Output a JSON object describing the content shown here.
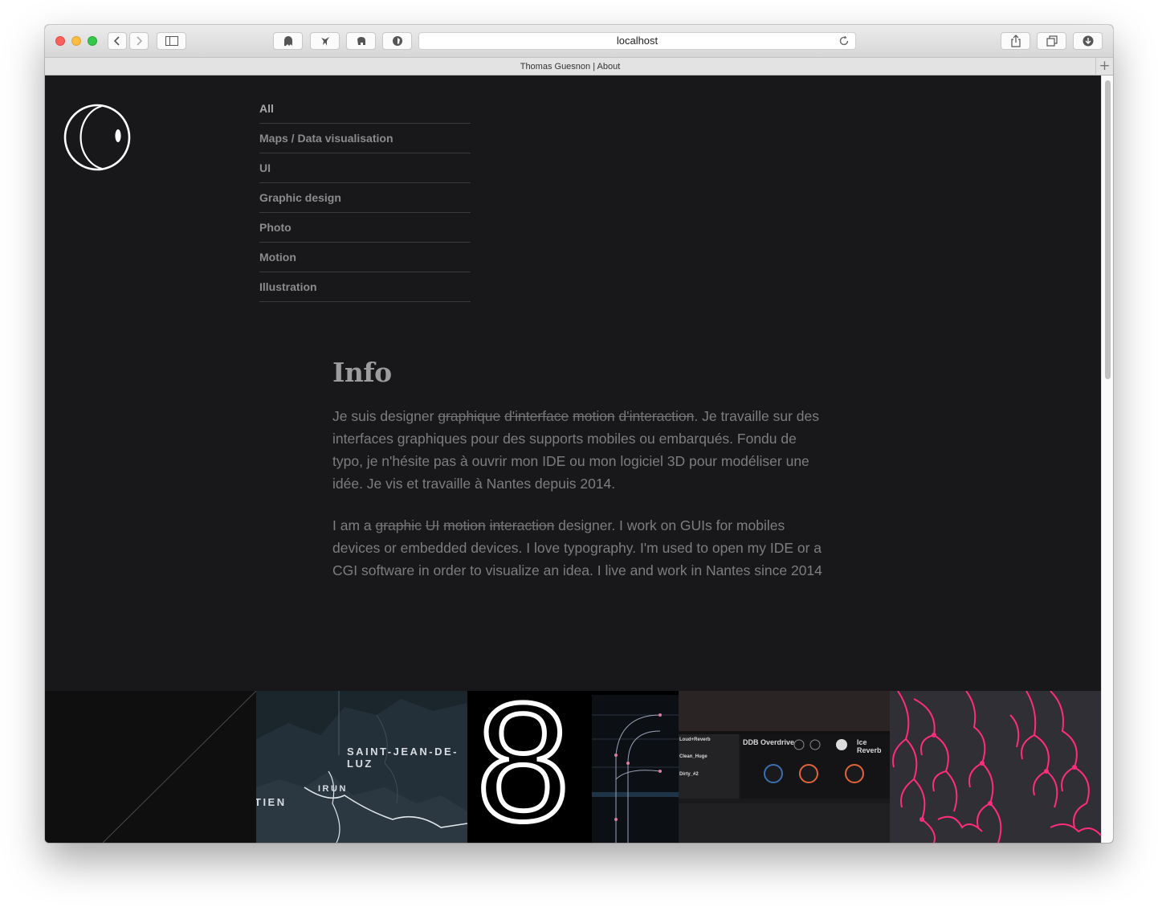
{
  "browser": {
    "url": "localhost",
    "tab_title": "Thomas Guesnon | About",
    "new_tab_label": "+"
  },
  "nav": {
    "items": [
      {
        "label": "All"
      },
      {
        "label": "Maps / Data visualisation"
      },
      {
        "label": "UI"
      },
      {
        "label": "Graphic design"
      },
      {
        "label": "Photo"
      },
      {
        "label": "Motion"
      },
      {
        "label": "Illustration"
      }
    ]
  },
  "info": {
    "title": "Info",
    "fr": {
      "prefix": "Je suis designer ",
      "struck": [
        "graphique",
        "d'interface",
        "motion",
        "d'interaction"
      ],
      "suffix": ". Je travaille sur des interfaces graphiques pour des supports mobiles ou embarqués. Fondu de typo, je n'hésite pas à ouvrir mon IDE ou mon logiciel 3D pour modéliser une idée. Je vis et travaille à Nantes depuis 2014."
    },
    "en": {
      "prefix": "I am a ",
      "struck": [
        "graphic",
        "UI",
        "motion",
        "interaction"
      ],
      "suffix": " designer. I work on GUIs for mobiles devices or embedded devices. I love typography. I'm used to open my IDE or a CGI software in order to visualize an idea. I live and work in Nantes since 2014"
    }
  },
  "gallery": {
    "map": {
      "label_city": "SAINT-JEAN-DE-LUZ",
      "label_irun": "IRUN",
      "label_partial": "TIEN"
    },
    "type": {
      "glyph": "8"
    },
    "plugin": {
      "presets": [
        "Loud+Reverb",
        "Clean_Huge",
        "Dirty_#2"
      ],
      "module_a": "DDB Overdrive",
      "module_b": "Ice Reverb"
    }
  },
  "colors": {
    "page_bg": "#18181a",
    "nav_text": "#8b8b8d",
    "body_text": "#7d7d80",
    "title_text": "#9c9c9e",
    "illustration_pink": "#ff2d7a"
  }
}
